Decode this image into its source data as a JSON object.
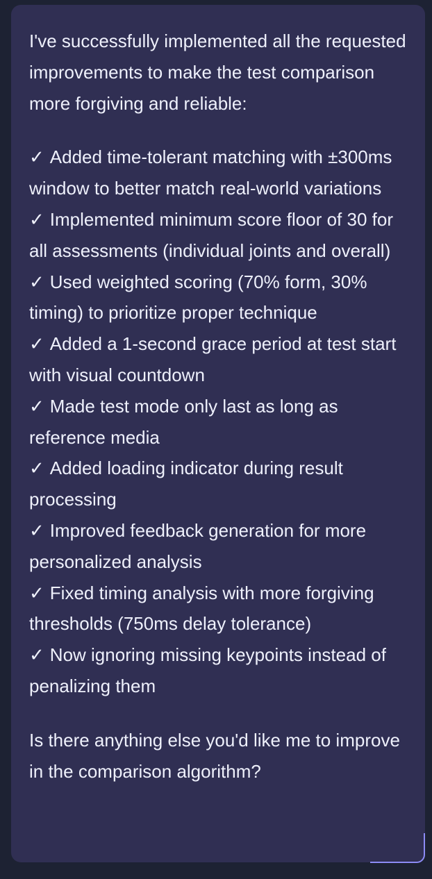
{
  "message": {
    "intro": "I've successfully implemented all the requested improvements to make the test comparison more forgiving and reliable:",
    "check_glyph": "✓",
    "items": [
      "Added time-tolerant matching with ±300ms window to better match real-world variations",
      "Implemented minimum score floor of 30 for all assessments (individual joints and overall)",
      "Used weighted scoring (70% form, 30% timing) to prioritize proper technique",
      "Added a 1-second grace period at test start with visual countdown",
      "Made test mode only last as long as reference media",
      "Added loading indicator during result processing",
      "Improved feedback generation for more personalized analysis",
      "Fixed timing analysis with more forgiving thresholds (750ms delay tolerance)",
      "Now ignoring missing keypoints instead of penalizing them"
    ],
    "closing": "Is there anything else you'd like me to improve in the comparison algorithm?"
  },
  "colors": {
    "page_background": "#1d2233",
    "bubble_background": "#302f53",
    "text": "#eef0fb",
    "accent": "#8c8bf5"
  }
}
